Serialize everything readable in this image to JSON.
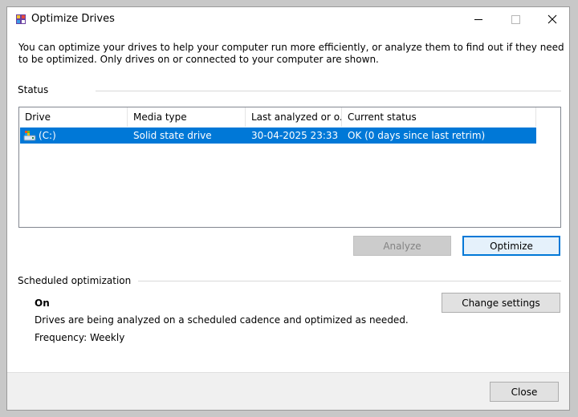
{
  "window": {
    "title": "Optimize Drives",
    "controls": {
      "minimize": "minimize-icon",
      "maximize": "maximize-icon",
      "close": "close-icon"
    }
  },
  "description": "You can optimize your drives to help your computer run more efficiently, or analyze them to find out if they need to be optimized. Only drives on or connected to your computer are shown.",
  "status": {
    "label": "Status",
    "columns": [
      "Drive",
      "Media type",
      "Last analyzed or o...",
      "Current status"
    ],
    "rows": [
      {
        "icon": "drive-icon",
        "drive": "(C:)",
        "media_type": "Solid state drive",
        "last_analyzed": "30-04-2025 23:33",
        "current_status": "OK (0 days since last retrim)",
        "selected": true
      }
    ],
    "analyze_label": "Analyze",
    "optimize_label": "Optimize"
  },
  "scheduled": {
    "label": "Scheduled optimization",
    "state": "On",
    "description": "Drives are being analyzed on a scheduled cadence and optimized as needed.",
    "frequency": "Frequency: Weekly",
    "change_settings_label": "Change settings"
  },
  "footer": {
    "close_label": "Close"
  },
  "colors": {
    "selection": "#0078d7",
    "selection_text": "#ffffff",
    "disabled_text": "#838383"
  }
}
